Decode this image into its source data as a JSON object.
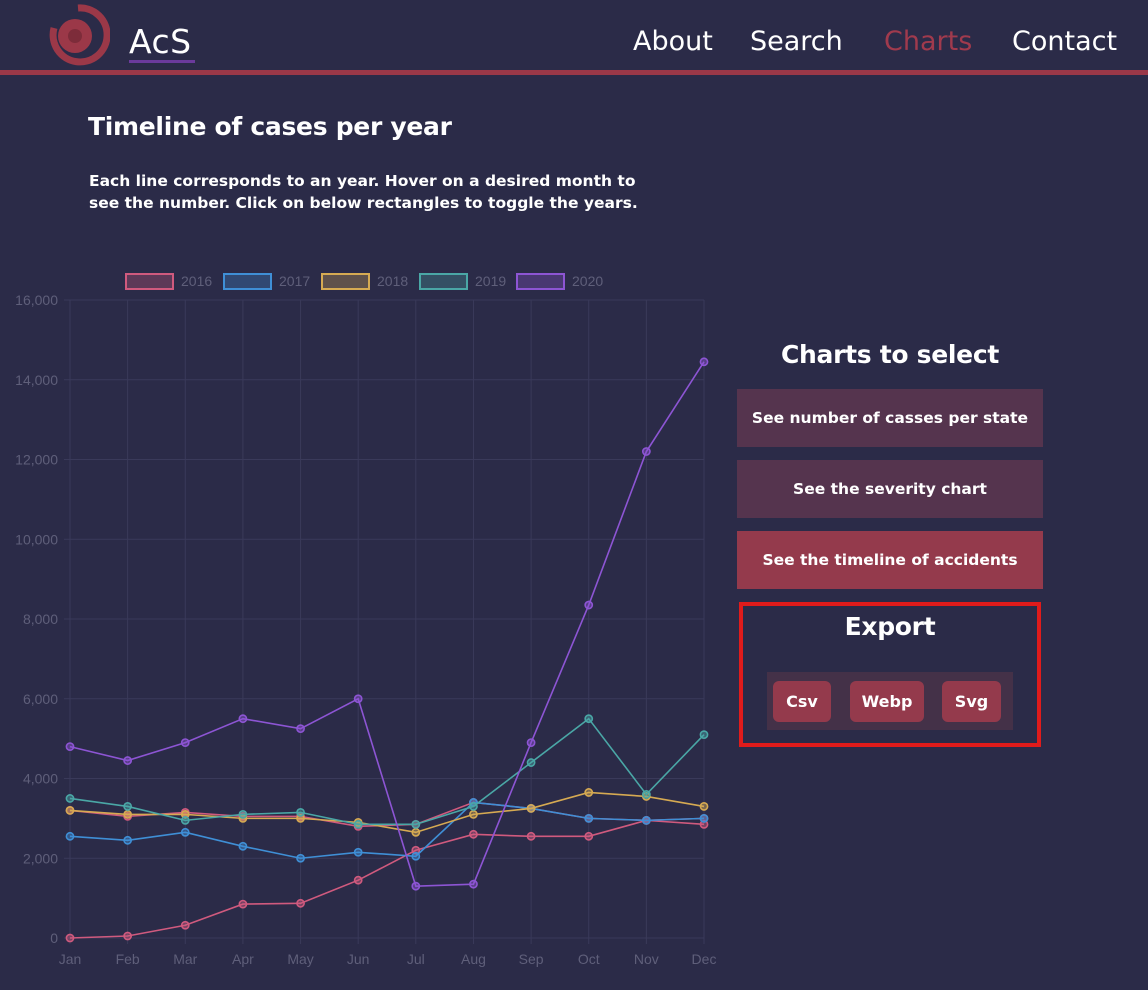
{
  "header": {
    "brand": "AcS",
    "nav": [
      "About",
      "Search",
      "Charts",
      "Contact"
    ],
    "active_nav": "Charts",
    "accent_color": "#9b3848"
  },
  "main": {
    "title": "Timeline of cases per year",
    "description": "Each line corresponds to an year. Hover on a desired month to see the number. Click on below rectangles to toggle the years."
  },
  "side": {
    "title": "Charts to select",
    "buttons": [
      "See number of casses per state",
      "See the severity chart",
      "See the timeline of accidents"
    ],
    "active_button": "See the timeline of accidents",
    "export_title": "Export",
    "export_buttons": [
      "Csv",
      "Webp",
      "Svg"
    ]
  },
  "chart_data": {
    "type": "line",
    "title": "",
    "xlabel": "",
    "ylabel": "",
    "x": [
      "Jan",
      "Feb",
      "Mar",
      "Apr",
      "May",
      "Jun",
      "Jul",
      "Aug",
      "Sep",
      "Oct",
      "Nov",
      "Dec"
    ],
    "ylim": [
      0,
      16000
    ],
    "yticks": [
      "0",
      "2,000",
      "4,000",
      "6,000",
      "8,000",
      "10,000",
      "12,000",
      "14,000",
      "16,000"
    ],
    "grid": true,
    "legend_position": "top",
    "series": [
      {
        "name": "2016",
        "color": "#d05a7e",
        "values": [
          3200,
          3050,
          3150,
          3050,
          3050,
          2800,
          2850,
          3400,
          3250,
          3000,
          2950,
          2850
        ]
      },
      {
        "name": "2016",
        "color": "#d05a7e",
        "values": [
          0,
          50,
          320,
          850,
          870,
          1450,
          2200,
          2600,
          2550,
          2550,
          2950,
          3000
        ]
      },
      {
        "name": "2017",
        "color": "#3f8fd6",
        "values": [
          2550,
          2450,
          2650,
          2300,
          2000,
          2150,
          2050,
          3400,
          3250,
          3000,
          2950,
          3000
        ]
      },
      {
        "name": "2018",
        "color": "#d6aa52",
        "values": [
          3200,
          3100,
          3100,
          3000,
          3000,
          2900,
          2650,
          3100,
          3250,
          3650,
          3550,
          3300
        ]
      },
      {
        "name": "2019",
        "color": "#4aa7a6",
        "values": [
          3500,
          3300,
          2950,
          3100,
          3150,
          2850,
          2850,
          3300,
          4400,
          5500,
          3600,
          5100
        ]
      },
      {
        "name": "2020",
        "color": "#8d55d4",
        "values": [
          4800,
          4450,
          4900,
          5500,
          5250,
          6000,
          1300,
          1350,
          4900,
          8350,
          12200,
          14450
        ]
      }
    ],
    "legend": [
      {
        "name": "2016",
        "color": "#d05a7e"
      },
      {
        "name": "2017",
        "color": "#3f8fd6"
      },
      {
        "name": "2018",
        "color": "#d6aa52"
      },
      {
        "name": "2019",
        "color": "#4aa7a6"
      },
      {
        "name": "2020",
        "color": "#8d55d4"
      }
    ]
  }
}
